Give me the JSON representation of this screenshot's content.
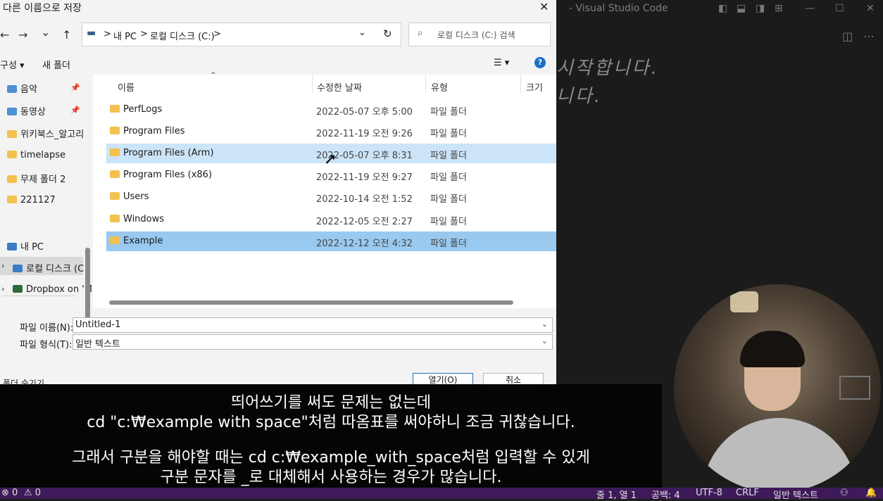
{
  "vscode": {
    "window_title": "- Visual Studio Code",
    "editor_line1": "시작합니다.",
    "editor_line2": "니다."
  },
  "dialog": {
    "title": "다른 이름으로 저장",
    "close_glyph": "✕",
    "nav": {
      "back": "←",
      "forward": "→",
      "recent": "⌄",
      "up": "↑"
    },
    "address": {
      "segments": [
        "내 PC",
        ">",
        "로컬 디스크 (C:)",
        ">"
      ],
      "leading_sep": ">"
    },
    "search_placeholder": "로컬 디스크 (C:) 검색",
    "toolbar": {
      "organize": "구성 ▾",
      "new_folder": "새 폴더",
      "view": "☰ ▾",
      "help": "?"
    },
    "sidebar": {
      "items": [
        {
          "label": "음악",
          "icon": "music-folder-icon",
          "pinned": true
        },
        {
          "label": "동영상",
          "icon": "video-folder-icon",
          "pinned": true
        },
        {
          "label": "위키북스_알고리",
          "icon": "folder-icon"
        },
        {
          "label": "timelapse",
          "icon": "folder-icon"
        },
        {
          "label": "무제 폴더 2",
          "icon": "folder-icon"
        },
        {
          "label": "221127",
          "icon": "folder-icon"
        },
        {
          "label": "내 PC",
          "icon": "pc-icon"
        },
        {
          "label": "로컬 디스크 (C",
          "icon": "drive-icon"
        },
        {
          "label": "Dropbox on 'M",
          "icon": "drive-icon"
        }
      ]
    },
    "columns": {
      "name": "이름",
      "date": "수정한 날짜",
      "type": "유형",
      "size": "크기"
    },
    "rows": [
      {
        "name": "PerfLogs",
        "date": "2022-05-07 오후 5:00",
        "type": "파일 폴더"
      },
      {
        "name": "Program Files",
        "date": "2022-11-19 오전 9:26",
        "type": "파일 폴더"
      },
      {
        "name": "Program Files (Arm)",
        "date": "2022-05-07 오후 8:31",
        "type": "파일 폴더"
      },
      {
        "name": "Program Files (x86)",
        "date": "2022-11-19 오전 9:27",
        "type": "파일 폴더"
      },
      {
        "name": "Users",
        "date": "2022-10-14 오전 1:52",
        "type": "파일 폴더"
      },
      {
        "name": "Windows",
        "date": "2022-12-05 오전 2:27",
        "type": "파일 폴더"
      },
      {
        "name": "Example",
        "date": "2022-12-12 오전 4:32",
        "type": "파일 폴더"
      }
    ],
    "filename_label": "파일 이름(N):",
    "filename_value": "Untitled-1",
    "filetype_label": "파일 형식(T):",
    "filetype_value": "일반 텍스트",
    "hide_folders": "폴더 숨기기",
    "open_button": "열기(O)",
    "cancel_button": "취소"
  },
  "subtitles": {
    "line1": "띄어쓰기를 써도 문제는 없는데",
    "line2": "cd \"c:₩example with space\"처럼 따옴표를 써야하니 조금 귀찮습니다.",
    "line3": "그래서 구분을 해야할 때는 cd c:₩example_with_space처럼 입력할 수 있게",
    "line4": "구분 문자를 _로 대체해서 사용하는 경우가 많습니다."
  },
  "statusbar": {
    "errors": "⊗ 0",
    "warnings": "⚠ 0",
    "position": "줄 1, 열 1",
    "spaces": "공백: 4",
    "encoding": "UTF-8",
    "eol": "CRLF",
    "language": "일반 텍스트"
  }
}
